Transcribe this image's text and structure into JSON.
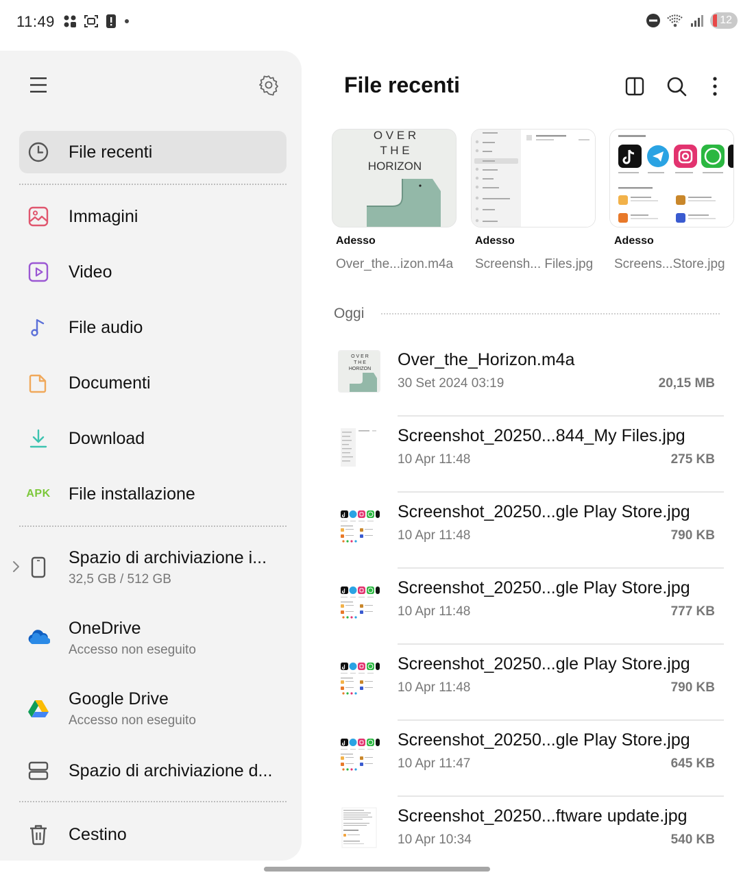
{
  "status": {
    "time": "11:49",
    "battery": "12"
  },
  "sidebar": {
    "items": [
      {
        "label": "File recenti",
        "icon": "clock-icon",
        "color": "#555555"
      },
      {
        "label": "Immagini",
        "icon": "image-icon",
        "color": "#e0566e"
      },
      {
        "label": "Video",
        "icon": "video-icon",
        "color": "#9b57d3"
      },
      {
        "label": "File audio",
        "icon": "music-note-icon",
        "color": "#5a6fd8"
      },
      {
        "label": "Documenti",
        "icon": "document-icon",
        "color": "#f0a85a"
      },
      {
        "label": "Download",
        "icon": "download-icon",
        "color": "#3cc3b0"
      },
      {
        "label": "File installazione",
        "icon": "apk-icon",
        "apk_text": "APK",
        "color": "#7cc83a"
      }
    ],
    "storage": [
      {
        "label": "Spazio di archiviazione i...",
        "sub": "32,5 GB / 512 GB",
        "icon": "phone-icon"
      },
      {
        "label": "OneDrive",
        "sub": "Accesso non eseguito",
        "icon": "onedrive-icon"
      },
      {
        "label": "Google Drive",
        "sub": "Accesso non eseguito",
        "icon": "google-drive-icon"
      },
      {
        "label": "Spazio di archiviazione d...",
        "icon": "server-icon"
      }
    ],
    "trash": {
      "label": "Cestino",
      "icon": "trash-icon"
    }
  },
  "main": {
    "title": "File recenti",
    "recent_thumbs": [
      {
        "caption": "Adesso",
        "name": "Over_the...izon.m4a",
        "art_text": [
          "O V E R",
          "T  H  E",
          "HORIZON"
        ]
      },
      {
        "caption": "Adesso",
        "name": "Screensh... Files.jpg"
      },
      {
        "caption": "Adesso",
        "name": "Screens...Store.jpg"
      }
    ],
    "section": "Oggi",
    "files": [
      {
        "name": "Over_the_Horizon.m4a",
        "date": "30 Set 2024 03:19",
        "size": "20,15 MB",
        "kind": "album"
      },
      {
        "name": "Screenshot_20250...844_My Files.jpg",
        "date": "10 Apr 11:48",
        "size": "275 KB",
        "kind": "myfiles"
      },
      {
        "name": "Screenshot_20250...gle Play Store.jpg",
        "date": "10 Apr 11:48",
        "size": "790 KB",
        "kind": "playstore"
      },
      {
        "name": "Screenshot_20250...gle Play Store.jpg",
        "date": "10 Apr 11:48",
        "size": "777 KB",
        "kind": "playstore"
      },
      {
        "name": "Screenshot_20250...gle Play Store.jpg",
        "date": "10 Apr 11:48",
        "size": "790 KB",
        "kind": "playstore"
      },
      {
        "name": "Screenshot_20250...gle Play Store.jpg",
        "date": "10 Apr 11:47",
        "size": "645 KB",
        "kind": "playstore"
      },
      {
        "name": "Screenshot_20250...ftware update.jpg",
        "date": "10 Apr 10:34",
        "size": "540 KB",
        "kind": "doc"
      }
    ]
  }
}
